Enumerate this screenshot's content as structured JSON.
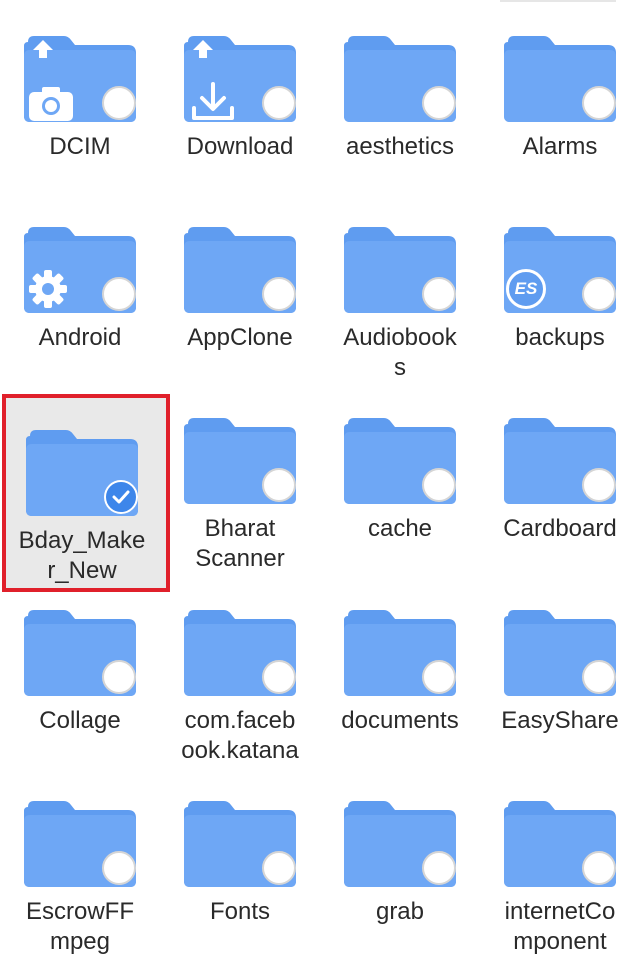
{
  "colors": {
    "folder_body": "#6ea7f5",
    "folder_tab": "#5f9cf0",
    "selection_border": "#e0202b",
    "selection_bg": "#e9e9e9",
    "check_on": "#3d86ea"
  },
  "folders": [
    {
      "label": "DCIM",
      "badge": "camera-icon",
      "top_badge": "upload-arrow-icon",
      "selected": false
    },
    {
      "label": "Download",
      "badge": "download-icon",
      "top_badge": "upload-arrow-icon",
      "selected": false
    },
    {
      "label": "aesthetics",
      "selected": false
    },
    {
      "label": "Alarms",
      "selected": false
    },
    {
      "label": "Android",
      "badge": "gear-icon",
      "selected": false
    },
    {
      "label": "AppClone",
      "selected": false
    },
    {
      "label": "Audiobook\ns",
      "selected": false
    },
    {
      "label": "backups",
      "badge": "es-logo-icon",
      "selected": false
    },
    {
      "label": "Bday_Make\nr_New",
      "selected": true
    },
    {
      "label": "Bharat\nScanner",
      "selected": false
    },
    {
      "label": "cache",
      "selected": false
    },
    {
      "label": "Cardboard",
      "selected": false
    },
    {
      "label": "Collage",
      "selected": false
    },
    {
      "label": "com.faceb\nook.katana",
      "selected": false
    },
    {
      "label": "documents",
      "selected": false
    },
    {
      "label": "EasyShare",
      "selected": false
    },
    {
      "label": "EscrowFF\nmpeg",
      "selected": false
    },
    {
      "label": "Fonts",
      "selected": false
    },
    {
      "label": "grab",
      "selected": false
    },
    {
      "label": "internetCo\nmponent",
      "selected": false
    }
  ],
  "badge_text": {
    "es_logo": "ES"
  }
}
